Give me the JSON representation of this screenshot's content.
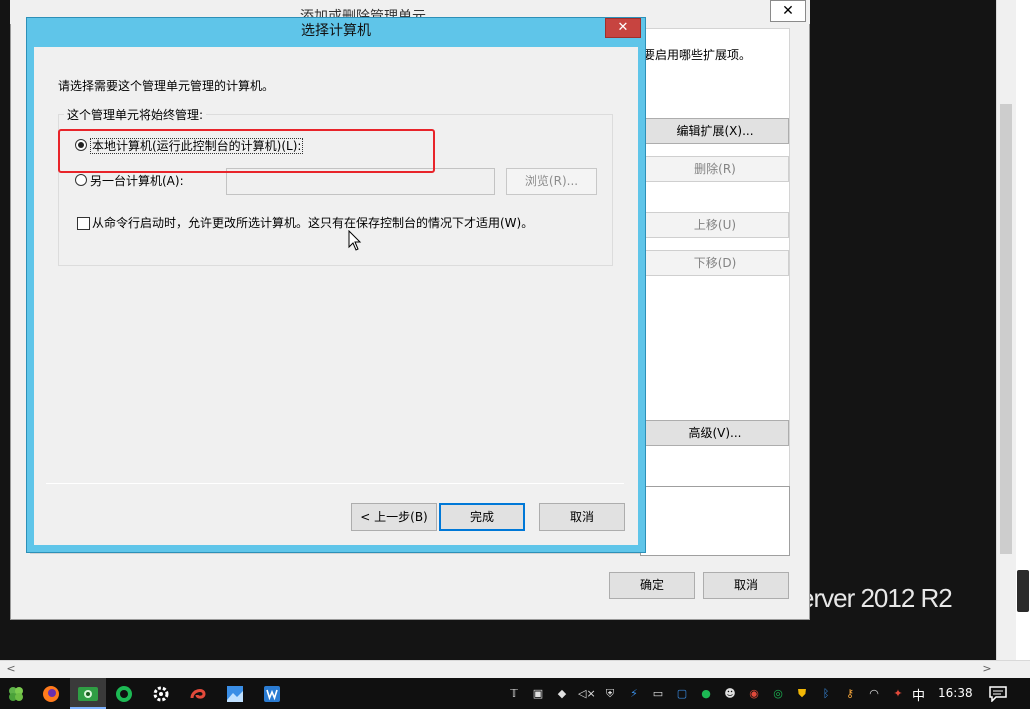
{
  "desktop": {
    "brand_text": "erver 2012 R2"
  },
  "background_dialog": {
    "title": "添加或删除管理单元",
    "close_glyph": "✕",
    "description_fragment": "要启用哪些扩展项。",
    "buttons": {
      "edit_extensions": "编辑扩展(X)...",
      "remove": "删除(R)",
      "move_up": "上移(U)",
      "move_down": "下移(D)",
      "advanced": "高级(V)...",
      "ok": "确定",
      "cancel": "取消"
    }
  },
  "dialog": {
    "title": "选择计算机",
    "close_glyph": "✕",
    "instruction": "请选择需要这个管理单元管理的计算机。",
    "group_label": "这个管理单元将始终管理:",
    "options": {
      "local": {
        "label": "本地计算机(运行此控制台的计算机)(L):",
        "checked": true
      },
      "another": {
        "label": "另一台计算机(A):",
        "checked": false,
        "input_value": ""
      }
    },
    "browse_button": "浏览(R)...",
    "allow_change_checkbox": {
      "label": "从命令行启动时，允许更改所选计算机。这只有在保存控制台的情况下才适用(W)。",
      "checked": false
    },
    "buttons": {
      "back": "< 上一步(B)",
      "finish": "完成",
      "cancel": "取消"
    }
  },
  "taskbar": {
    "apps": [
      {
        "name": "start-icon",
        "color": "#5fb34a"
      },
      {
        "name": "firefox-icon",
        "color": "#ff7b1c"
      },
      {
        "name": "remote-app-icon",
        "color": "#2f9e44"
      },
      {
        "name": "green-circle-app-icon",
        "color": "#1db954"
      },
      {
        "name": "gear-icon",
        "color": "#ffffff"
      },
      {
        "name": "swirl-app-icon",
        "color": "#e24a3b"
      },
      {
        "name": "photo-app-icon",
        "color": "#3a8ee6"
      },
      {
        "name": "writer-app-icon",
        "color": "#2b7cd3"
      }
    ],
    "ime": "中",
    "time": "16:38"
  }
}
